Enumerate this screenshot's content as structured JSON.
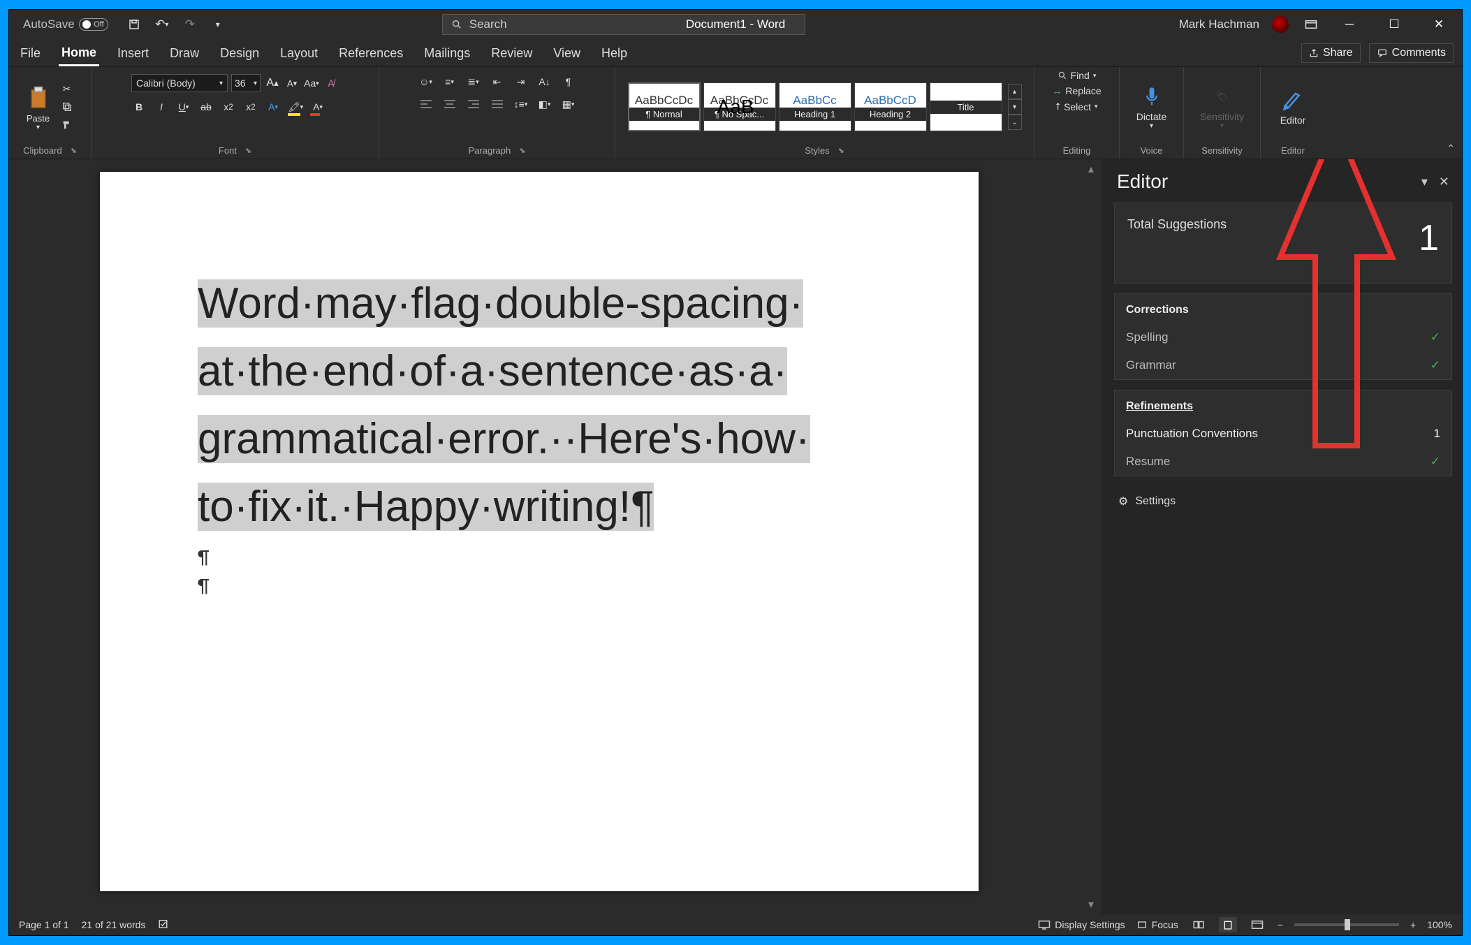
{
  "title": "Document1  -  Word",
  "autosave": {
    "label": "AutoSave",
    "state": "Off"
  },
  "search_placeholder": "Search",
  "user_name": "Mark Hachman",
  "tabs": [
    "File",
    "Home",
    "Insert",
    "Draw",
    "Design",
    "Layout",
    "References",
    "Mailings",
    "Review",
    "View",
    "Help"
  ],
  "active_tab": "Home",
  "share_label": "Share",
  "comments_label": "Comments",
  "ribbon": {
    "clipboard": {
      "paste": "Paste",
      "group": "Clipboard"
    },
    "font": {
      "name": "Calibri (Body)",
      "size": "36",
      "group": "Font"
    },
    "paragraph": {
      "group": "Paragraph"
    },
    "styles": {
      "group": "Styles",
      "tiles": [
        {
          "preview": "AaBbCcDc",
          "name": "¶ Normal",
          "cls": ""
        },
        {
          "preview": "AaBbCcDc",
          "name": "¶ No Spac...",
          "cls": ""
        },
        {
          "preview": "AaBbCc",
          "name": "Heading 1",
          "cls": "heading"
        },
        {
          "preview": "AaBbCcD",
          "name": "Heading 2",
          "cls": "heading"
        },
        {
          "preview": "AaB",
          "name": "Title",
          "cls": "title"
        }
      ]
    },
    "editing": {
      "find": "Find",
      "replace": "Replace",
      "select": "Select",
      "group": "Editing"
    },
    "dictate": "Dictate",
    "sensitivity": "Sensitivity",
    "editor": "Editor",
    "voice_group": "Voice",
    "sensitivity_group": "Sensitivity",
    "editor_group": "Editor"
  },
  "document_text": "Word·may·flag·double-spacing·​at·the·end·of·a·sentence·as·a·​grammatical·error.··Here's·how·​to·fix·it.·Happy·writing!¶",
  "editor_pane": {
    "title": "Editor",
    "total_label": "Total Suggestions",
    "total_count": "1",
    "corrections_label": "Corrections",
    "spelling": "Spelling",
    "grammar": "Grammar",
    "refinements_label": "Refinements",
    "punctuation": "Punctuation Conventions",
    "punctuation_count": "1",
    "resume": "Resume",
    "settings": "Settings"
  },
  "statusbar": {
    "page": "Page 1 of 1",
    "words": "21 of 21 words",
    "display_settings": "Display Settings",
    "focus": "Focus",
    "zoom": "100%"
  }
}
